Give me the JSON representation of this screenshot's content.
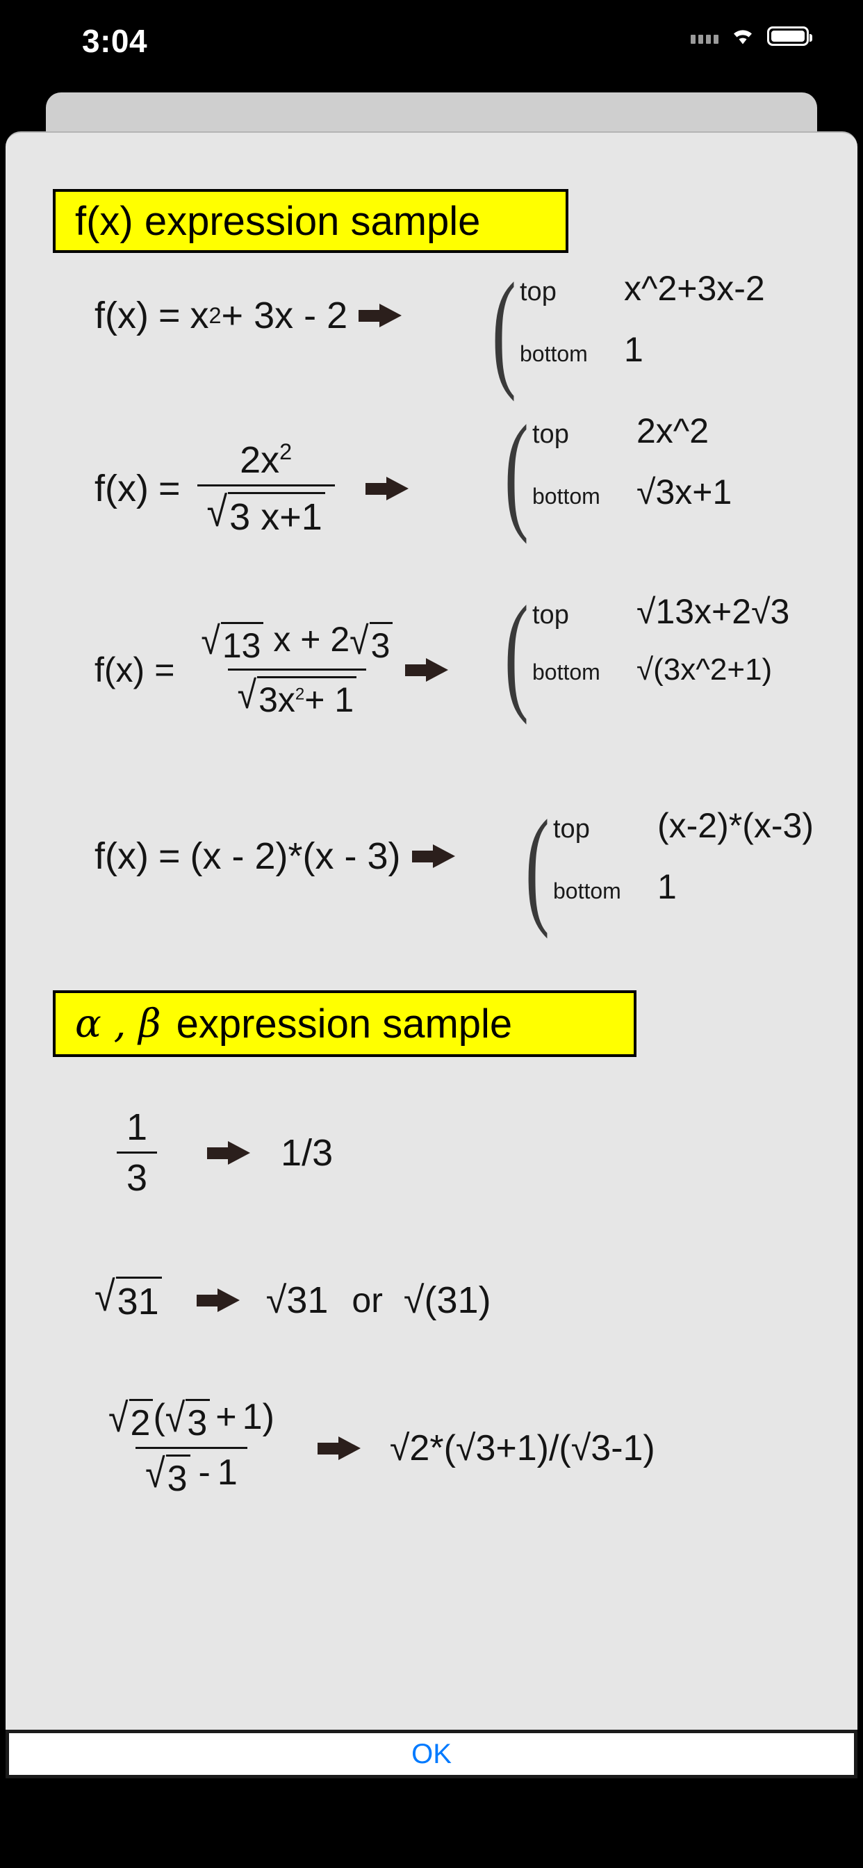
{
  "status_bar": {
    "time": "3:04",
    "signal_icon": "signal-dots-icon",
    "wifi_icon": "wifi-icon",
    "battery_icon": "battery-icon"
  },
  "dialog": {
    "sections": [
      {
        "banner": {
          "prefix": "",
          "label": "f(x)  expression sample"
        },
        "rows": [
          {
            "id": "fx-row-1",
            "left_plain": "f(x) = x^2+ 3x - 2",
            "arrow_icon": "arrow-right-icon",
            "keys": {
              "top": "top",
              "bottom": "bottom"
            },
            "top_value": "x^2+3x-2",
            "bottom_value": "1"
          },
          {
            "id": "fx-row-2",
            "left_plain": "f(x) = 2x^2 / (√3 x+1)",
            "arrow_icon": "arrow-right-icon",
            "keys": {
              "top": "top",
              "bottom": "bottom"
            },
            "top_value": "2x^2",
            "bottom_value": "√3x+1"
          },
          {
            "id": "fx-row-3",
            "left_plain": "f(x) = (√13 x + 2√3) / (√(3x^2+1))",
            "arrow_icon": "arrow-right-icon",
            "keys": {
              "top": "top",
              "bottom": "bottom"
            },
            "top_value": "√13x+2√3",
            "bottom_value": "√(3x^2+1)"
          },
          {
            "id": "fx-row-4",
            "left_plain": "f(x) = (x - 2)*(x - 3)",
            "arrow_icon": "arrow-right-icon",
            "keys": {
              "top": "top",
              "bottom": "bottom"
            },
            "top_value": "(x-2)*(x-3)",
            "bottom_value": "1"
          }
        ]
      },
      {
        "banner": {
          "prefix": "α , β",
          "label": "expression sample"
        },
        "rows": [
          {
            "id": "ab-row-1",
            "left_plain": "1/3 (stacked fraction)",
            "arrow_icon": "arrow-right-icon",
            "result": "1/3",
            "numerator": "1",
            "denominator": "3"
          },
          {
            "id": "ab-row-2",
            "left_plain": "√31",
            "arrow_icon": "arrow-right-icon",
            "result_a": "√31",
            "conjunction": "or",
            "result_b": "√(31)",
            "radicand": "31"
          },
          {
            "id": "ab-row-3",
            "left_plain": "√2(√3 + 1) / (√3 - 1)",
            "arrow_icon": "arrow-right-icon",
            "result": "√2*(√3+1)/(√3-1)"
          }
        ]
      }
    ],
    "ok_button": "OK"
  },
  "tokens": {
    "f_of_x": "f(x)",
    "equals": "=",
    "x": "x",
    "two": "2",
    "three": "3",
    "one": "1",
    "thirteen": "13",
    "plus_3x_minus_2": "+ 3x - 2",
    "num_2x": "2x",
    "den_3x_plus_1": "3 x+1",
    "num13x_plus": " x + 2",
    "den_3x2_plus1": "3x",
    "plus_1": "+ 1",
    "paren_expr": "(x - 2)*(x - 3)",
    "sqrt_glyph": "√",
    "open_paren": "(",
    "close_paren": ")",
    "plus": "+",
    "minus": "-",
    "or": "or"
  },
  "colors": {
    "banner_bg": "#ffff00",
    "banner_border": "#000000",
    "sheet_bg": "#e6e6e6",
    "arrow": "#2b1f1c",
    "ok_text": "#007aff",
    "status_bg": "#000000"
  }
}
